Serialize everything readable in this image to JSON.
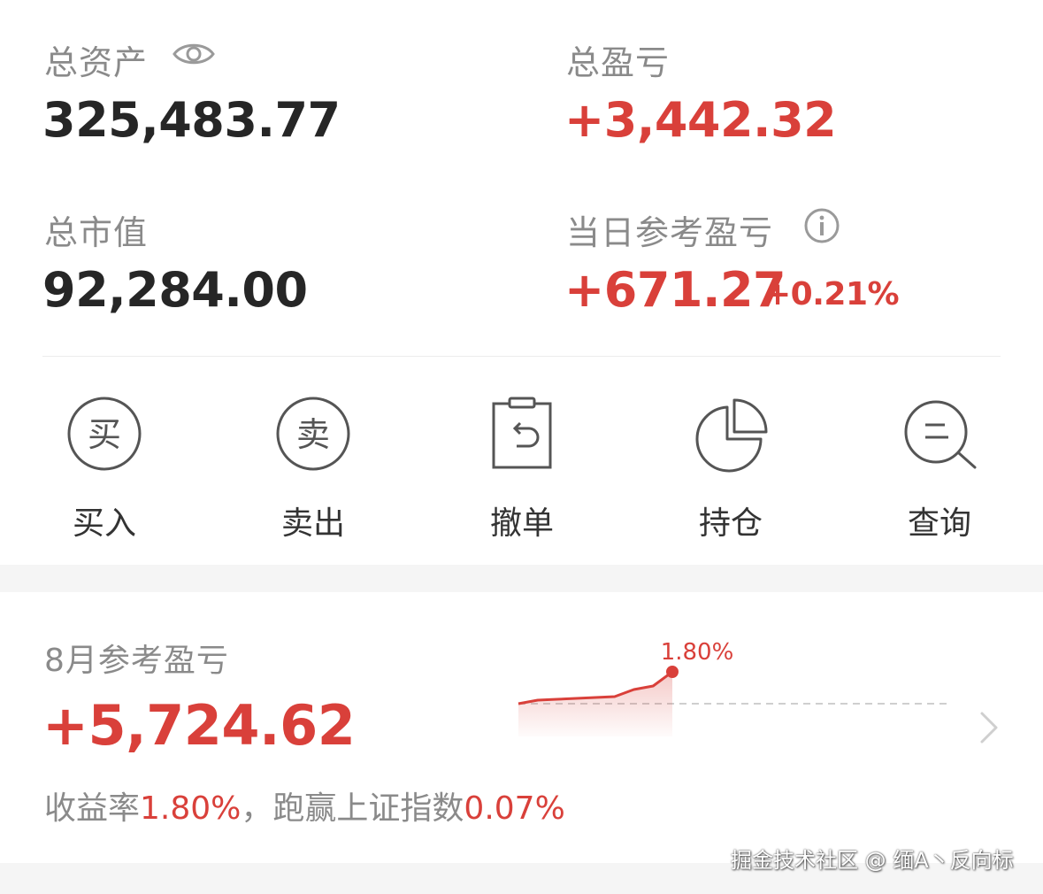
{
  "summary": {
    "total_assets_label": "总资产",
    "total_assets_value": "325,483.77",
    "total_pnl_label": "总盈亏",
    "total_pnl_value": "+3,442.32",
    "market_value_label": "总市值",
    "market_value_value": "92,284.00",
    "daily_pnl_label": "当日参考盈亏",
    "daily_pnl_value": "+671.27",
    "daily_pnl_pct": "+0.21%"
  },
  "actions": [
    {
      "label": "买入",
      "glyph": "买",
      "icon": "buy-icon"
    },
    {
      "label": "卖出",
      "glyph": "卖",
      "icon": "sell-icon"
    },
    {
      "label": "撤单",
      "icon": "cancel-order-icon"
    },
    {
      "label": "持仓",
      "icon": "pie-chart-icon"
    },
    {
      "label": "查询",
      "icon": "search-icon"
    }
  ],
  "monthly": {
    "label": "8月参考盈亏",
    "value": "+5,724.62",
    "return_label": "收益率",
    "return_value": "1.80%",
    "separator": "，",
    "beat_label": "跑赢上证指数",
    "beat_value": "0.07%"
  },
  "chart_data": {
    "type": "area",
    "values": [
      0.0,
      0.2,
      0.25,
      0.3,
      0.35,
      0.4,
      0.8,
      1.0,
      1.8
    ],
    "end_label": "1.80%"
  },
  "colors": {
    "accent_red": "#d9403a",
    "text_dark": "#262626",
    "text_gray": "#8a8a8a"
  },
  "watermark": "掘金技术社区 @ 缅A丶反向标"
}
